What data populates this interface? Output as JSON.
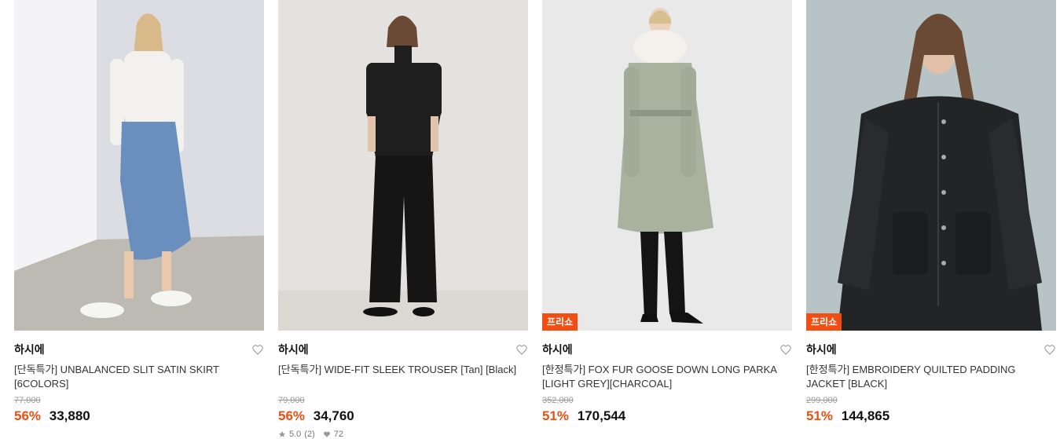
{
  "products": [
    {
      "badge": "",
      "brand": "하시에",
      "name": "[단독특가] UNBALANCED SLIT SATIN SKIRT [6COLORS]",
      "original_price": "77,000",
      "discount": "56%",
      "price": "33,880",
      "rating": "",
      "review_count": "",
      "likes": "",
      "image": "woman-white-top-blue-satin-skirt"
    },
    {
      "badge": "",
      "brand": "하시에",
      "name": "[단독특가] WIDE-FIT SLEEK TROUSER [Tan] [Black]",
      "original_price": "79,000",
      "discount": "56%",
      "price": "34,760",
      "rating": "5.0",
      "review_count": "(2)",
      "likes": "72",
      "image": "woman-black-top-black-wide-trousers"
    },
    {
      "badge": "프리쇼",
      "brand": "하시에",
      "name": "[한정특가] FOX FUR GOOSE DOWN LONG PARKA [LIGHT GREY][CHARCOAL]",
      "original_price": "352,000",
      "discount": "51%",
      "price": "170,544",
      "rating": "",
      "review_count": "",
      "likes": "",
      "image": "woman-sage-long-down-parka-fur-collar"
    },
    {
      "badge": "프리쇼",
      "brand": "하시에",
      "name": "[한정특가] EMBROIDERY QUILTED PADDING JACKET [BLACK]",
      "original_price": "299,000",
      "discount": "51%",
      "price": "144,865",
      "rating": "",
      "review_count": "",
      "likes": "",
      "image": "woman-black-quilted-padding-jacket"
    }
  ],
  "colors": {
    "accent": "#f04e12",
    "text": "#111111",
    "muted": "#999999"
  },
  "icons": {
    "wishlist": "heart-outline-icon",
    "rating": "star-icon",
    "likes": "heart-filled-icon"
  }
}
